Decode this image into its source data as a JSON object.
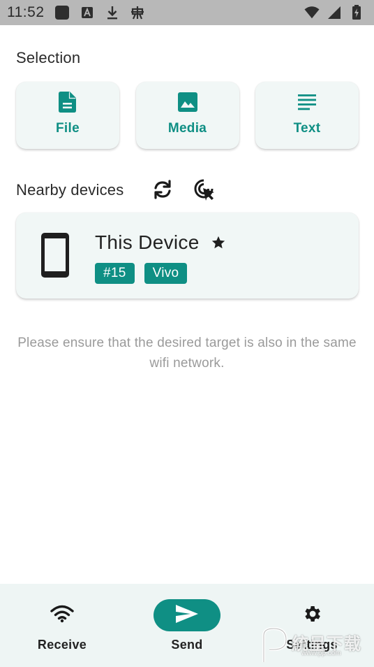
{
  "status_bar": {
    "time": "11:52",
    "left_icons": [
      "app-square-icon",
      "font-a-icon",
      "download-icon",
      "bug-icon"
    ],
    "right_icons": [
      "wifi-icon",
      "cell-signal-icon",
      "battery-charging-icon"
    ]
  },
  "selection": {
    "title": "Selection",
    "options": [
      {
        "label": "File",
        "icon": "file-icon"
      },
      {
        "label": "Media",
        "icon": "image-icon"
      },
      {
        "label": "Text",
        "icon": "text-lines-icon"
      }
    ]
  },
  "nearby": {
    "title": "Nearby devices",
    "actions": [
      {
        "icon": "refresh-icon"
      },
      {
        "icon": "cursor-target-icon"
      }
    ]
  },
  "device": {
    "name": "This Device",
    "icon": "phone-icon",
    "star": "star-icon",
    "chips": [
      "#15",
      "Vivo"
    ]
  },
  "hint": "Please ensure that the desired target is also in the same wifi network.",
  "bottom_nav": {
    "items": [
      {
        "label": "Receive",
        "icon": "wifi-icon",
        "active": false
      },
      {
        "label": "Send",
        "icon": "send-icon",
        "active": true
      },
      {
        "label": "Settings",
        "icon": "gear-icon",
        "active": false
      }
    ]
  },
  "watermark": {
    "text": "統呈下载",
    "url": "www.pp.com"
  },
  "colors": {
    "accent": "#0f8f84",
    "card_bg": "#f1f7f6",
    "nav_bg": "#eef5f4",
    "status_bar": "#b8b8b8",
    "hint_text": "#9a9a9a"
  }
}
